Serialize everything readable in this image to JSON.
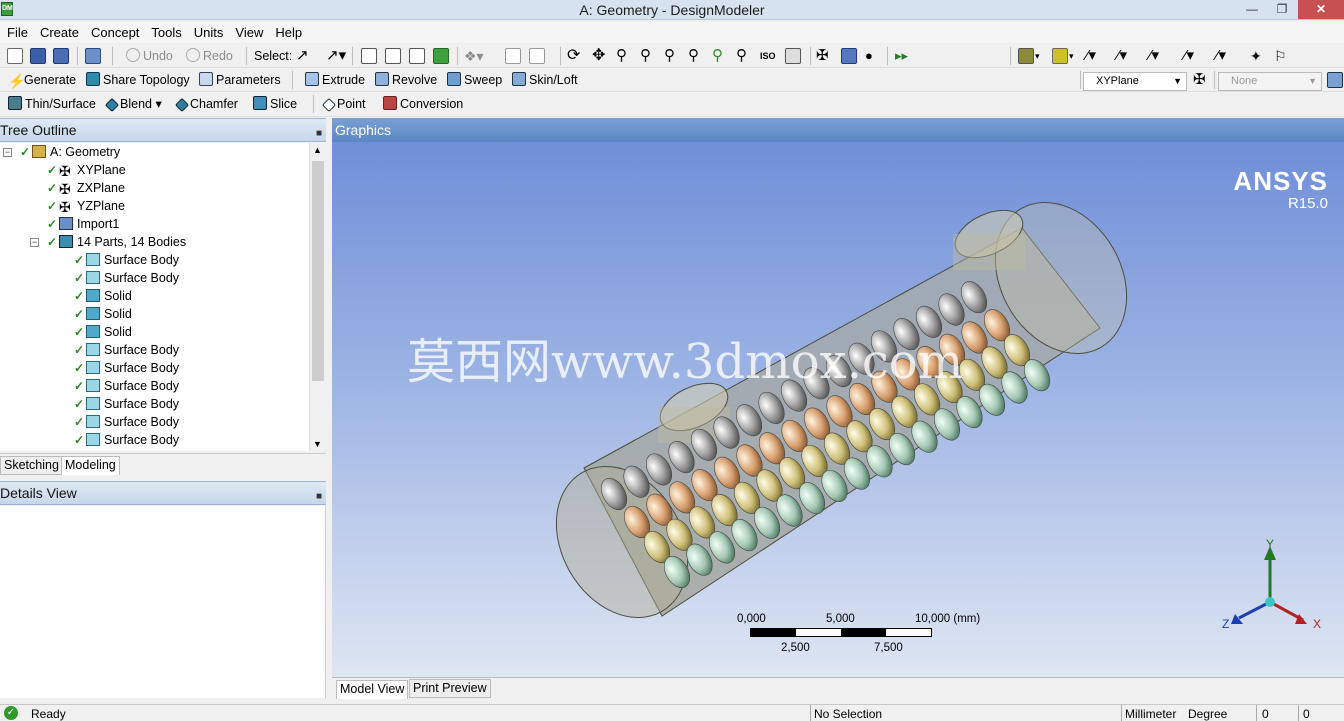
{
  "window": {
    "title": "A: Geometry - DesignModeler"
  },
  "menu": [
    "File",
    "Create",
    "Concept",
    "Tools",
    "Units",
    "View",
    "Help"
  ],
  "toolbar1": {
    "undo": "Undo",
    "redo": "Redo",
    "select": "Select:"
  },
  "toolbar2": {
    "generate": "Generate",
    "share_topology": "Share Topology",
    "parameters": "Parameters",
    "extrude": "Extrude",
    "revolve": "Revolve",
    "sweep": "Sweep",
    "skin_loft": "Skin/Loft",
    "plane_select": "XYPlane",
    "sketch_select": "None"
  },
  "toolbar3": {
    "thin_surface": "Thin/Surface",
    "blend": "Blend",
    "chamfer": "Chamfer",
    "slice": "Slice",
    "point": "Point",
    "conversion": "Conversion"
  },
  "tree_outline": {
    "title": "Tree Outline",
    "root": "A: Geometry",
    "planes": [
      "XYPlane",
      "ZXPlane",
      "YZPlane"
    ],
    "import": "Import1",
    "parts": "14 Parts, 14 Bodies",
    "bodies": [
      "Surface Body",
      "Surface Body",
      "Solid",
      "Solid",
      "Solid",
      "Surface Body",
      "Surface Body",
      "Surface Body",
      "Surface Body",
      "Surface Body",
      "Surface Body"
    ]
  },
  "left_tabs": [
    "Sketching",
    "Modeling"
  ],
  "details_view": {
    "title": "Details View"
  },
  "graphics": {
    "title": "Graphics",
    "brand": "ANSYS",
    "version": "R15.0",
    "watermark": "莫西网www.3dmox.com",
    "scale_top": [
      "0,000",
      "5,000",
      "10,000 (mm)"
    ],
    "scale_bottom": [
      "2,500",
      "7,500"
    ],
    "axes": {
      "y": "Y",
      "x": "X",
      "z": "Z"
    }
  },
  "bottom_tabs": [
    "Model View",
    "Print Preview"
  ],
  "status": {
    "ready": "Ready",
    "selection": "No Selection",
    "length_unit": "Millimeter",
    "angle_unit": "Degree",
    "val1": "0",
    "val2": "0"
  }
}
